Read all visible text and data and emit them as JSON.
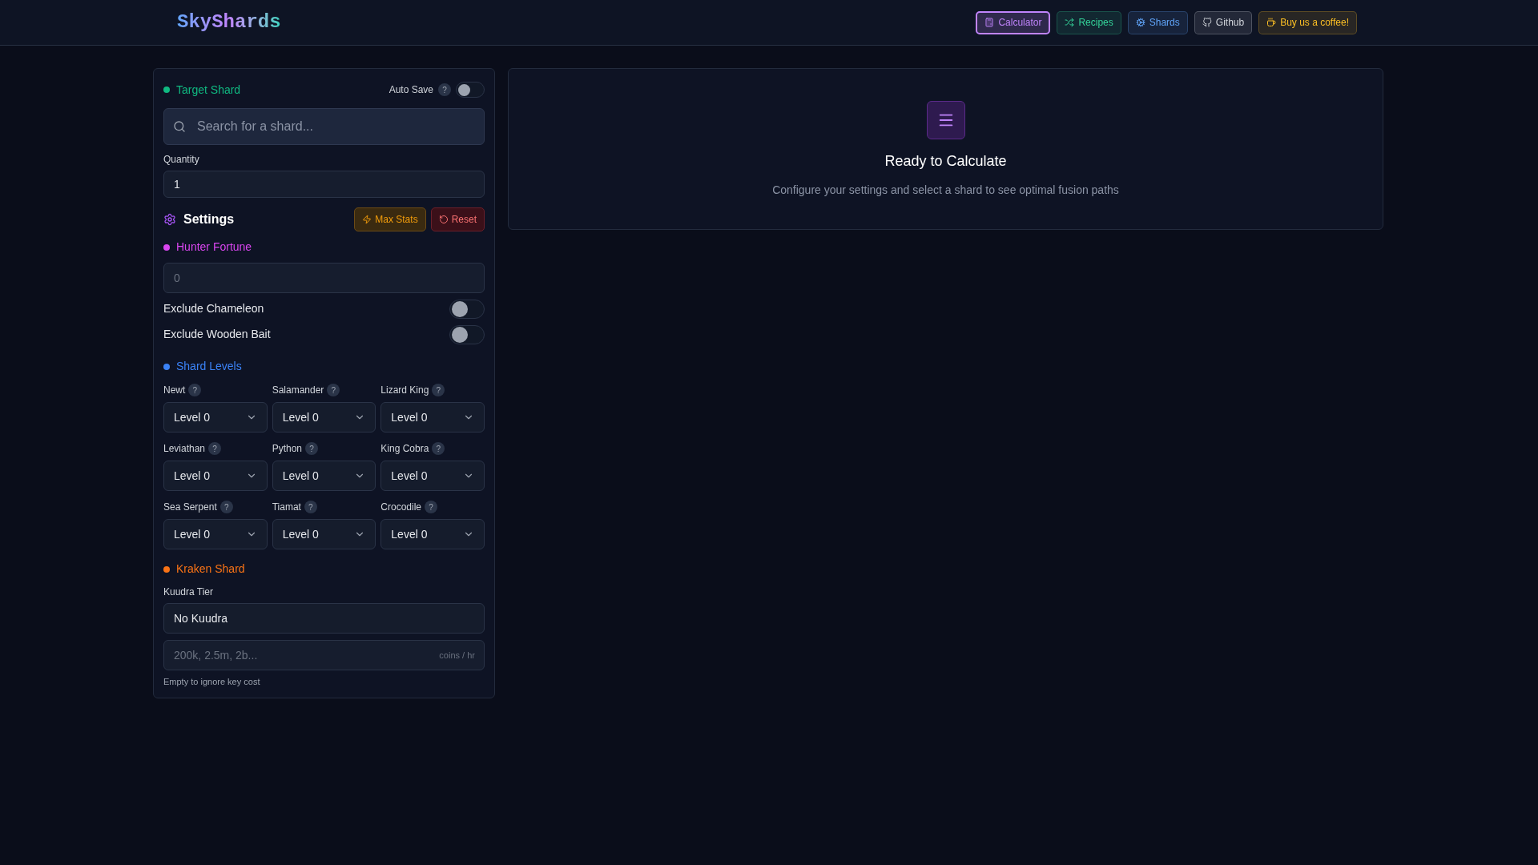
{
  "header": {
    "logo": "SkyShards",
    "nav": [
      {
        "label": "Calculator",
        "color": "#c084fc",
        "selected": true
      },
      {
        "label": "Recipes",
        "color": "#34d399",
        "selected": false
      },
      {
        "label": "Shards",
        "color": "#60a5fa",
        "selected": false
      },
      {
        "label": "Github",
        "color": "#d1d5db",
        "selected": false
      },
      {
        "label": "Buy us a coffee!",
        "color": "#fbbf24",
        "selected": false
      }
    ]
  },
  "target": {
    "label": "Target Shard",
    "color": "#10b981",
    "auto_save": {
      "label": "Auto Save",
      "help": "?",
      "on": false
    },
    "search": {
      "placeholder": "Search for a shard..."
    },
    "quantity": {
      "label": "Quantity",
      "value": "1"
    }
  },
  "settings": {
    "title": "Settings",
    "max_stats": "Max Stats",
    "reset": "Reset"
  },
  "hunter_fortune": {
    "label": "Hunter Fortune",
    "color": "#d946ef",
    "placeholder": "0"
  },
  "toggles": [
    {
      "label": "Exclude Chameleon",
      "on": false
    },
    {
      "label": "Exclude Wooden Bait",
      "on": false
    }
  ],
  "shard_levels": {
    "label": "Shard Levels",
    "color": "#3b82f6",
    "items": [
      {
        "name": "Newt",
        "help": "?",
        "value": "Level 0"
      },
      {
        "name": "Salamander",
        "help": "?",
        "value": "Level 0"
      },
      {
        "name": "Lizard King",
        "help": "?",
        "value": "Level 0"
      },
      {
        "name": "Leviathan",
        "help": "?",
        "value": "Level 0"
      },
      {
        "name": "Python",
        "help": "?",
        "value": "Level 0"
      },
      {
        "name": "King Cobra",
        "help": "?",
        "value": "Level 0"
      },
      {
        "name": "Sea Serpent",
        "help": "?",
        "value": "Level 0"
      },
      {
        "name": "Tiamat",
        "help": "?",
        "value": "Level 0"
      },
      {
        "name": "Crocodile",
        "help": "?",
        "value": "Level 0"
      }
    ]
  },
  "kraken": {
    "label": "Kraken Shard",
    "color": "#f97316",
    "tier": {
      "label": "Kuudra Tier",
      "value": "No Kuudra"
    },
    "key_cost": {
      "placeholder": "200k, 2.5m, 2b...",
      "suffix": "coins / hr"
    },
    "hint": "Empty to ignore key cost"
  },
  "result": {
    "title": "Ready to Calculate",
    "subtitle": "Configure your settings and select a shard to see optimal fusion paths"
  }
}
